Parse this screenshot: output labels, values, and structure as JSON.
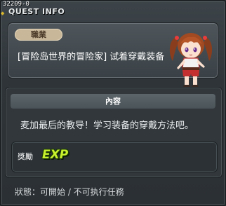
{
  "window": {
    "quest_id": "32209-0",
    "title": "QUEST INFO"
  },
  "job_panel": {
    "job_label": "職業",
    "quest_name": "[冒险岛世界的冒险家] 试着穿戴装备",
    "character_icon": "female-adventurer-character"
  },
  "content_panel": {
    "header": "內容",
    "description": "麦加最后的教导！学习装备的穿戴方法吧。",
    "reward": {
      "label": "獎勵",
      "exp_icon_text": "EXP"
    }
  },
  "status": {
    "text": "狀態：可開始 / 不可执行任務"
  },
  "colors": {
    "accent_yellow": "#d8b52d",
    "exp_green": "#c7f12c",
    "pill_tan": "#c9b79a"
  }
}
